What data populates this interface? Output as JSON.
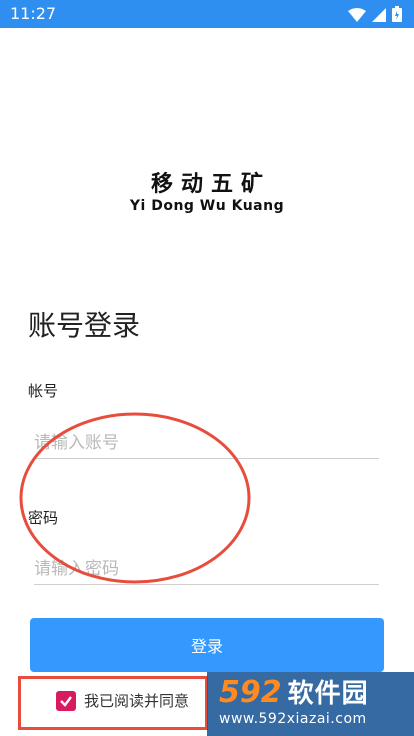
{
  "status_bar": {
    "time": "11:27",
    "icons": [
      "wifi-icon",
      "signal-icon",
      "battery-icon"
    ]
  },
  "logo": {
    "name_cn": "移动五矿",
    "name_en": "Yi Dong Wu Kuang"
  },
  "page_title": "账号登录",
  "account": {
    "label": "帐号",
    "placeholder": "请输入账号",
    "value": ""
  },
  "password": {
    "label": "密码",
    "placeholder": "请输入密码",
    "value": ""
  },
  "login_button": "登录",
  "agreement": {
    "checked": true,
    "text": "我已阅读并同意"
  },
  "watermark": {
    "number": "592",
    "name": "软件园",
    "url": "www.592xiazai.com"
  },
  "colors": {
    "status_bar": "#2f8ff0",
    "button": "#3399ff",
    "checkbox": "#d81b60",
    "annotation": "#e74c3c"
  }
}
